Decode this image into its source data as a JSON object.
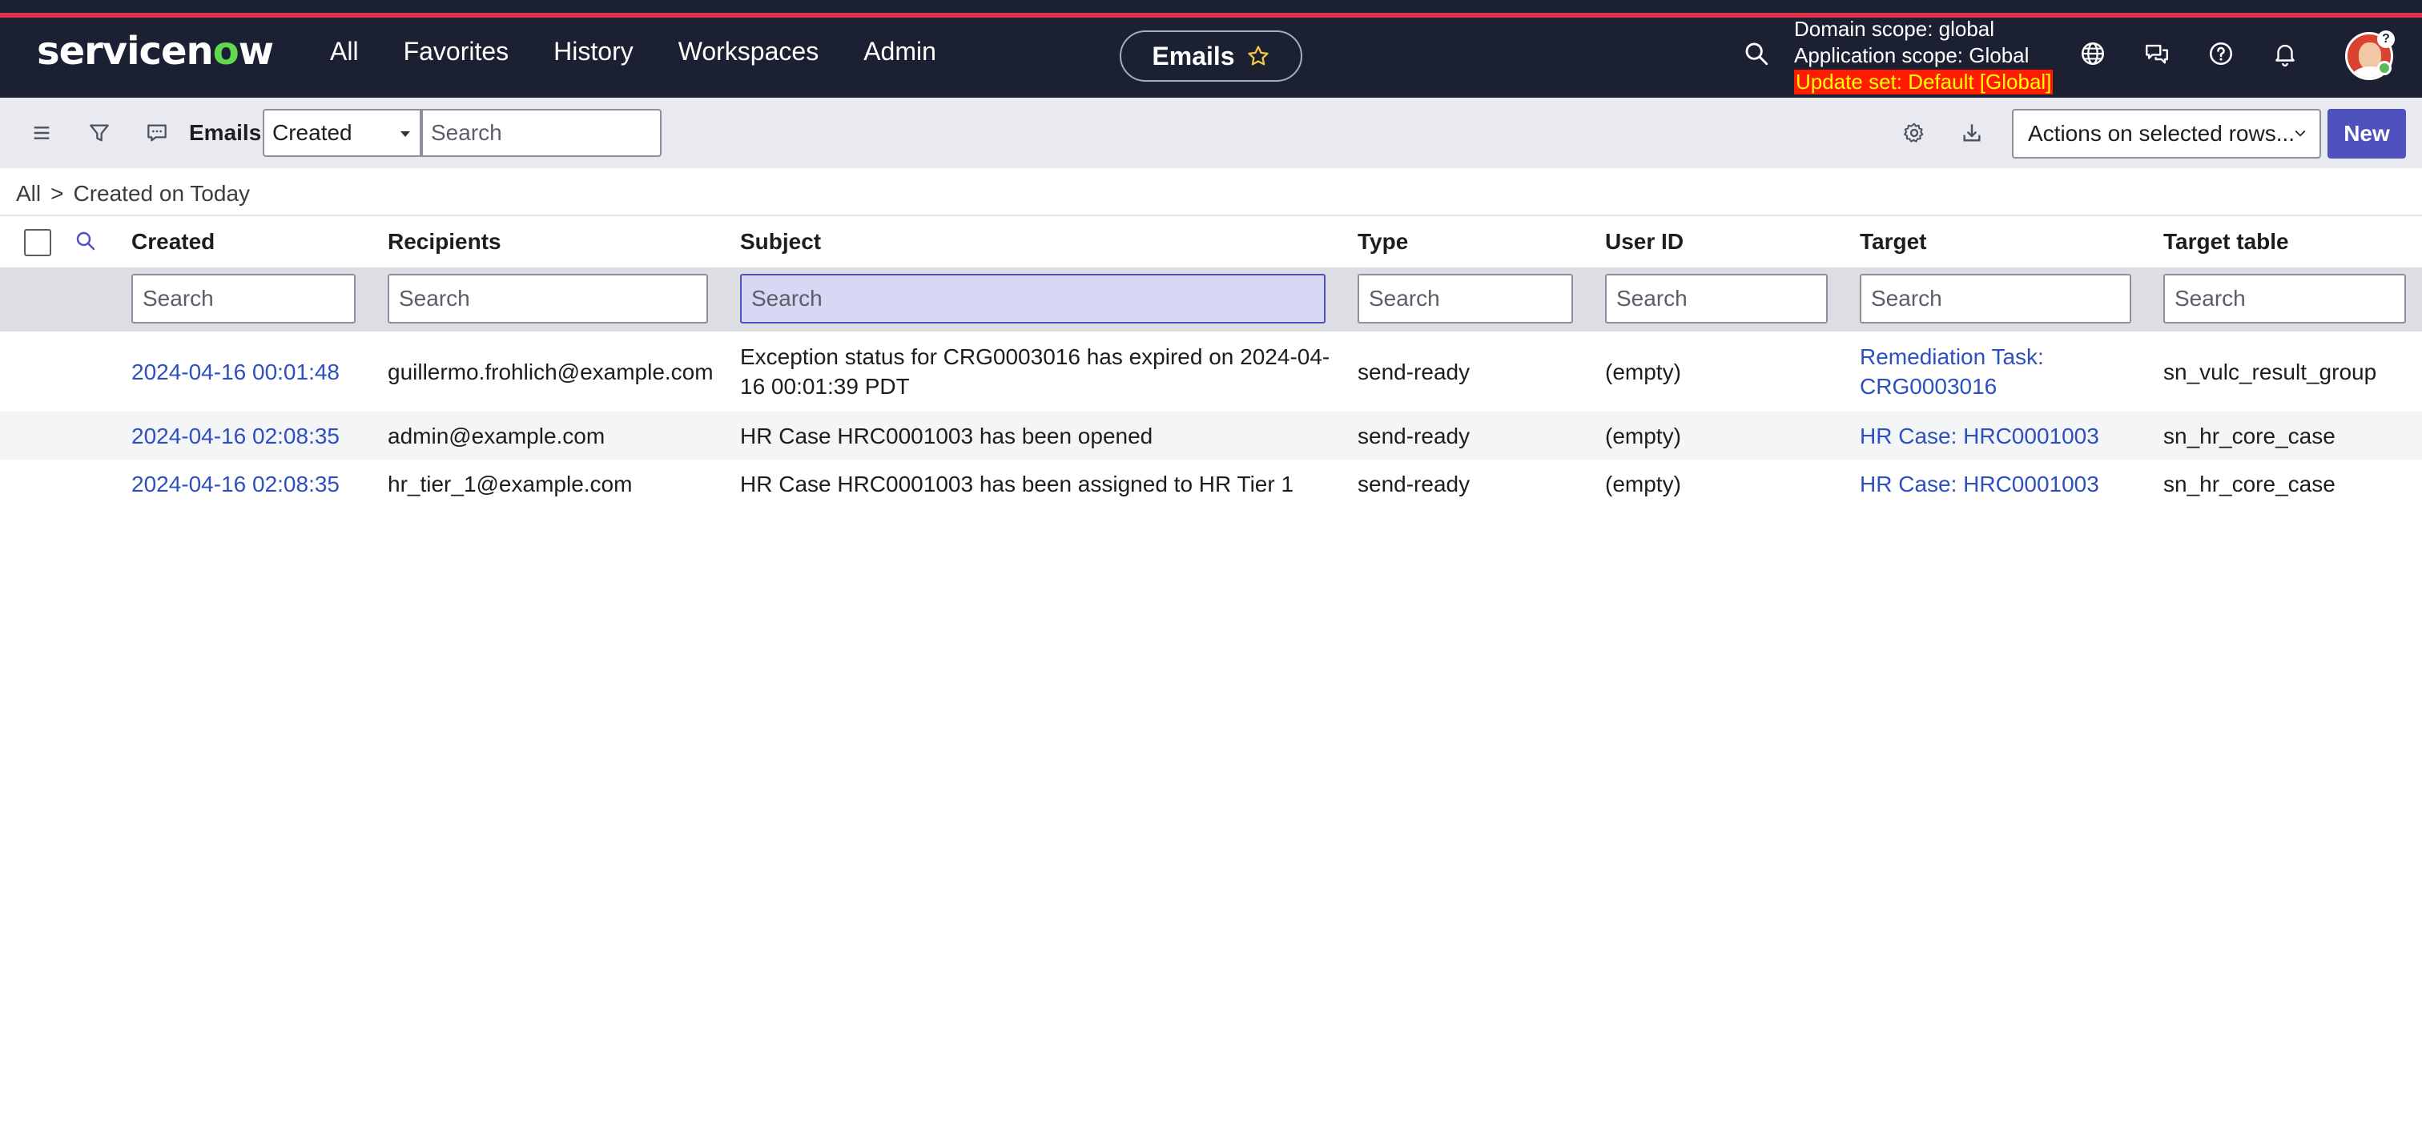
{
  "header": {
    "logo_text": "servicenow",
    "nav": [
      "All",
      "Favorites",
      "History",
      "Workspaces",
      "Admin"
    ],
    "context_title": "Emails",
    "scope": {
      "domain": "Domain scope: global",
      "application": "Application scope: Global",
      "update_set": "Update set: Default [Global]"
    },
    "avatar_badge": "?",
    "colors": {
      "bar": "#1c2033",
      "accent_line": "#e0344a",
      "update_set_bg": "#ff1a00",
      "update_set_text": "#ffff00"
    }
  },
  "toolbar": {
    "list_title": "Emails",
    "field_selected": "Created",
    "search_placeholder": "Search",
    "actions_label": "Actions on selected rows...",
    "new_label": "New"
  },
  "breadcrumb": {
    "root": "All",
    "separator": ">",
    "filter": "Created on Today"
  },
  "table": {
    "columns": [
      "Created",
      "Recipients",
      "Subject",
      "Type",
      "User ID",
      "Target",
      "Target table"
    ],
    "filter_placeholder": "Search",
    "rows": [
      {
        "created": "2024-04-16 00:01:48",
        "recipients": "guillermo.frohlich@example.com",
        "subject_line1": "Exception status for CRG0003016 has expired on 2024-04-",
        "subject_line2": "16 00:01:39 PDT",
        "type": "send-ready",
        "user_id": "(empty)",
        "target_line1": "Remediation Task:",
        "target_line2": "CRG0003016",
        "target_table": "sn_vulc_result_group"
      },
      {
        "created": "2024-04-16 02:08:35",
        "recipients": "admin@example.com",
        "subject": "HR Case HRC0001003 has been opened",
        "type": "send-ready",
        "user_id": "(empty)",
        "target": "HR Case: HRC0001003",
        "target_table": "sn_hr_core_case"
      },
      {
        "created": "2024-04-16 02:08:35",
        "recipients": "hr_tier_1@example.com",
        "subject": "HR Case HRC0001003 has been assigned to HR Tier 1",
        "type": "send-ready",
        "user_id": "(empty)",
        "target": "HR Case: HRC0001003",
        "target_table": "sn_hr_core_case"
      }
    ],
    "colors": {
      "link": "#2d4fc0",
      "new_button": "#4f52bd"
    }
  }
}
